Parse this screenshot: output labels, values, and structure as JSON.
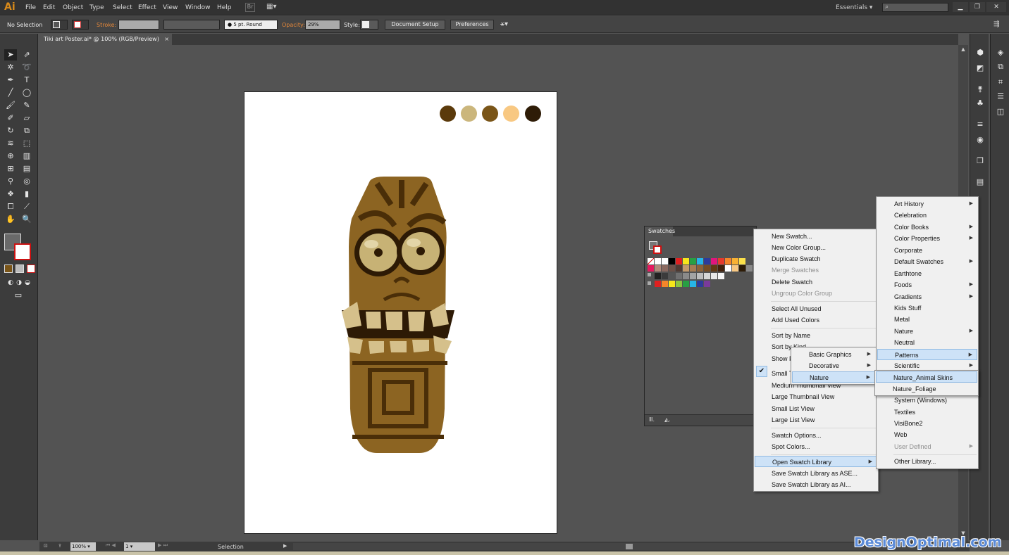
{
  "app": {
    "logo": "Ai",
    "workspace": "Essentials",
    "search_placeholder": ""
  },
  "menubar": [
    "File",
    "Edit",
    "Object",
    "Type",
    "Select",
    "Effect",
    "View",
    "Window",
    "Help"
  ],
  "control_bar": {
    "selection": "No Selection",
    "stroke_label": "Stroke:",
    "brush": "5 pt. Round",
    "opacity_label": "Opacity:",
    "opacity_value": "29%",
    "style_label": "Style:",
    "document_setup": "Document Setup",
    "preferences": "Preferences"
  },
  "document_tab": {
    "title": "Tiki art Poster.ai* @ 100% (RGB/Preview)",
    "close": "×"
  },
  "color_palette": {
    "colors": [
      "#5b3a0b",
      "#cbb67c",
      "#7a5518",
      "#f8c882",
      "#2e1c07"
    ]
  },
  "swatches_panel": {
    "title": "Swatches"
  },
  "flyout_menu": {
    "items": [
      {
        "label": "New Swatch...",
        "enabled": true
      },
      {
        "label": "New Color Group...",
        "enabled": true
      },
      {
        "label": "Duplicate Swatch",
        "enabled": true
      },
      {
        "label": "Merge Swatches",
        "enabled": false
      },
      {
        "label": "Delete Swatch",
        "enabled": true
      },
      {
        "label": "Ungroup Color Group",
        "enabled": false
      },
      {
        "label": "Select All Unused",
        "enabled": true
      },
      {
        "label": "Add Used Colors",
        "enabled": true
      },
      {
        "label": "Sort by Name",
        "enabled": true
      },
      {
        "label": "Sort by Kind",
        "enabled": true
      },
      {
        "label": "Show F",
        "enabled": true
      },
      {
        "label": "Small T",
        "enabled": true,
        "checked": true
      },
      {
        "label": "Medium Thumbnail View",
        "enabled": true
      },
      {
        "label": "Large Thumbnail View",
        "enabled": true
      },
      {
        "label": "Small List View",
        "enabled": true
      },
      {
        "label": "Large List View",
        "enabled": true
      },
      {
        "label": "Swatch Options...",
        "enabled": true
      },
      {
        "label": "Spot Colors...",
        "enabled": true
      },
      {
        "label": "Open Swatch Library",
        "enabled": true,
        "highlighted": true
      },
      {
        "label": "Save Swatch Library as ASE...",
        "enabled": true
      },
      {
        "label": "Save Swatch Library as AI...",
        "enabled": true
      }
    ]
  },
  "user_defined_menu": {
    "items": [
      "Basic Graphics",
      "Decorative",
      "Nature"
    ]
  },
  "library_menu": {
    "items": [
      {
        "label": "Art History",
        "sub": true
      },
      {
        "label": "Celebration",
        "sub": false
      },
      {
        "label": "Color Books",
        "sub": true
      },
      {
        "label": "Color Properties",
        "sub": true
      },
      {
        "label": "Corporate",
        "sub": false
      },
      {
        "label": "Default Swatches",
        "sub": true
      },
      {
        "label": "Earthtone",
        "sub": false
      },
      {
        "label": "Foods",
        "sub": true
      },
      {
        "label": "Gradients",
        "sub": true
      },
      {
        "label": "Kids Stuff",
        "sub": false
      },
      {
        "label": "Metal",
        "sub": false
      },
      {
        "label": "Nature",
        "sub": true
      },
      {
        "label": "Neutral",
        "sub": false
      },
      {
        "label": "Patterns",
        "sub": true,
        "highlighted": true
      },
      {
        "label": "Scientific",
        "sub": true
      },
      {
        "label": "System (Windows)",
        "sub": false
      },
      {
        "label": "Textiles",
        "sub": false
      },
      {
        "label": "VisiBone2",
        "sub": false
      },
      {
        "label": "Web",
        "sub": false
      },
      {
        "label": "User Defined",
        "sub": true,
        "disabled": true
      },
      {
        "label": "Other Library...",
        "sub": false
      }
    ]
  },
  "patterns_submenu": {
    "items": [
      "Nature_Animal Skins",
      "Nature_Foliage"
    ]
  },
  "status_bar": {
    "zoom": "100%",
    "page": "1",
    "mode": "Selection"
  },
  "watermark": "DesignOptimal.com"
}
